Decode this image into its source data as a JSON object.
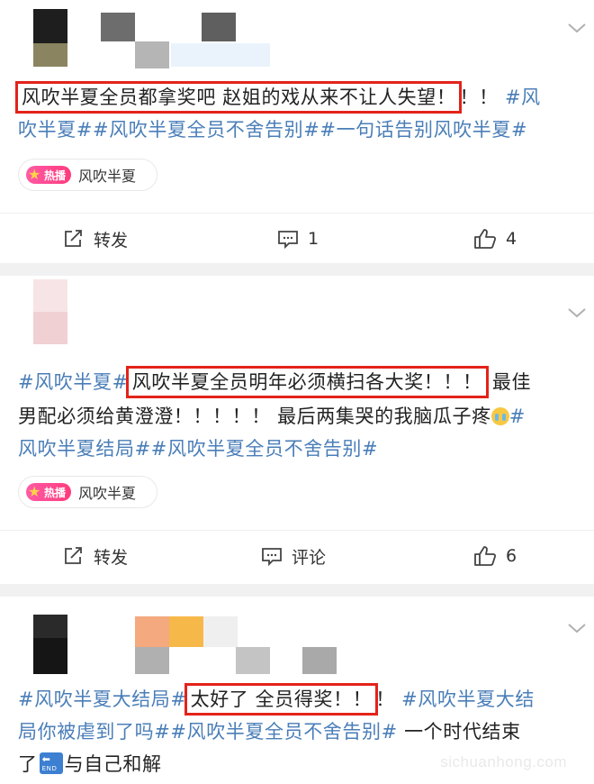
{
  "posts": [
    {
      "segments": [
        {
          "text": "风吹半夏全员都拿奖吧 赵姐的戏从来不让人失望！",
          "style": "hl"
        },
        {
          "text": "！！",
          "style": "plain"
        },
        {
          "text": "#风",
          "style": "tag"
        }
      ],
      "line2": "吹半夏##风吹半夏全员不舍告别##一句话告别风吹半夏#",
      "chip": {
        "badge": "热播",
        "label": "风吹半夏"
      },
      "actions": {
        "repost": "转发",
        "comment": "1",
        "like": "4"
      }
    },
    {
      "line1_tag": "#风吹半夏#",
      "line1_hl": "风吹半夏全员明年必须横扫各大奖！！！",
      "line1_tail": "最佳",
      "line2": "男配必须给黄澄澄！！！！！ 最后两集哭的我脑瓜子疼",
      "line2_tag": "#",
      "line3": "风吹半夏结局##风吹半夏全员不舍告别#",
      "chip": {
        "badge": "热播",
        "label": "风吹半夏"
      },
      "actions": {
        "repost": "转发",
        "comment": "评论",
        "like": "6"
      }
    },
    {
      "line1_tag": "#风吹半夏大结局#",
      "line1_hl": "太好了 全员得奖！！",
      "line1_plain": "！",
      "line1_tag2": "#风吹半夏大结",
      "line2_tag": "局你被虐到了吗##风吹半夏全员不舍告别#",
      "line2_plain": " 一个时代结束",
      "line3a": "了",
      "line3b": "与自己和解",
      "end_emoji_label": "END"
    }
  ],
  "watermark": "sichuanhong.com",
  "colors": {
    "hashtag": "#4a7eb8",
    "highlight_border": "#e3231a",
    "badge": "#ff3b7c"
  }
}
